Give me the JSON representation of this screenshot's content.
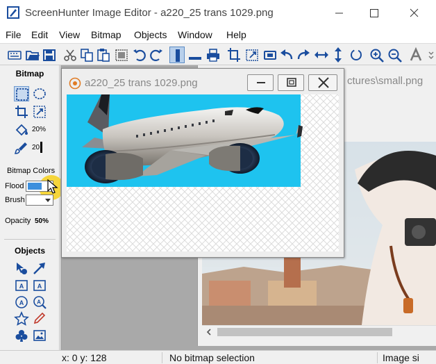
{
  "window": {
    "title": "ScreenHunter Image Editor - a220_25 trans 1029.png"
  },
  "menu": [
    "File",
    "Edit",
    "View",
    "Bitmap",
    "Objects",
    "Window",
    "Help"
  ],
  "left_panel": {
    "bitmap_heading": "Bitmap",
    "fill_tolerance": "20%",
    "brush_size": "20",
    "bitmap_colors_label": "Bitmap Colors",
    "flood_label": "Flood",
    "brush_label": "Brush",
    "opacity_label": "Opacity",
    "opacity_value": "50%",
    "objects_heading": "Objects",
    "text_tool_letter": "A"
  },
  "documents": {
    "front_title": "a220_25 trans 1029.png",
    "back_title_partial": "ctures\\small.png"
  },
  "status": {
    "coords": "x: 0 y: 128",
    "selection": "No bitmap selection",
    "image_size_partial": "Image si"
  },
  "colors": {
    "sky": "#1ec3ef",
    "flood": "#3d8fdd",
    "accent_blue": "#1a4d9e",
    "highlight": "#f5d227"
  }
}
